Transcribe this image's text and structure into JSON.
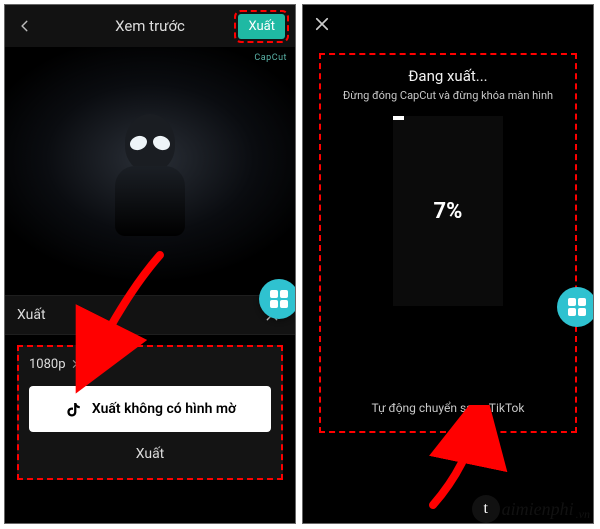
{
  "left": {
    "header": {
      "title": "Xem trước",
      "export_button": "Xuất"
    },
    "preview": {
      "watermark": "CapCut"
    },
    "export_row": {
      "label": "Xuất"
    },
    "panel": {
      "resolution": "1080p",
      "no_watermark_button": "Xuất không có hình mờ",
      "plain_export": "Xuất"
    }
  },
  "right": {
    "title": "Đang xuất...",
    "subtitle": "Đừng đóng CapCut và đừng khóa màn hình",
    "percent": "7%",
    "auto_share": "Tự động chuyển sang TikTok"
  },
  "watermark": {
    "letter": "t",
    "name": "aimienphi",
    "suffix": ".vn"
  }
}
